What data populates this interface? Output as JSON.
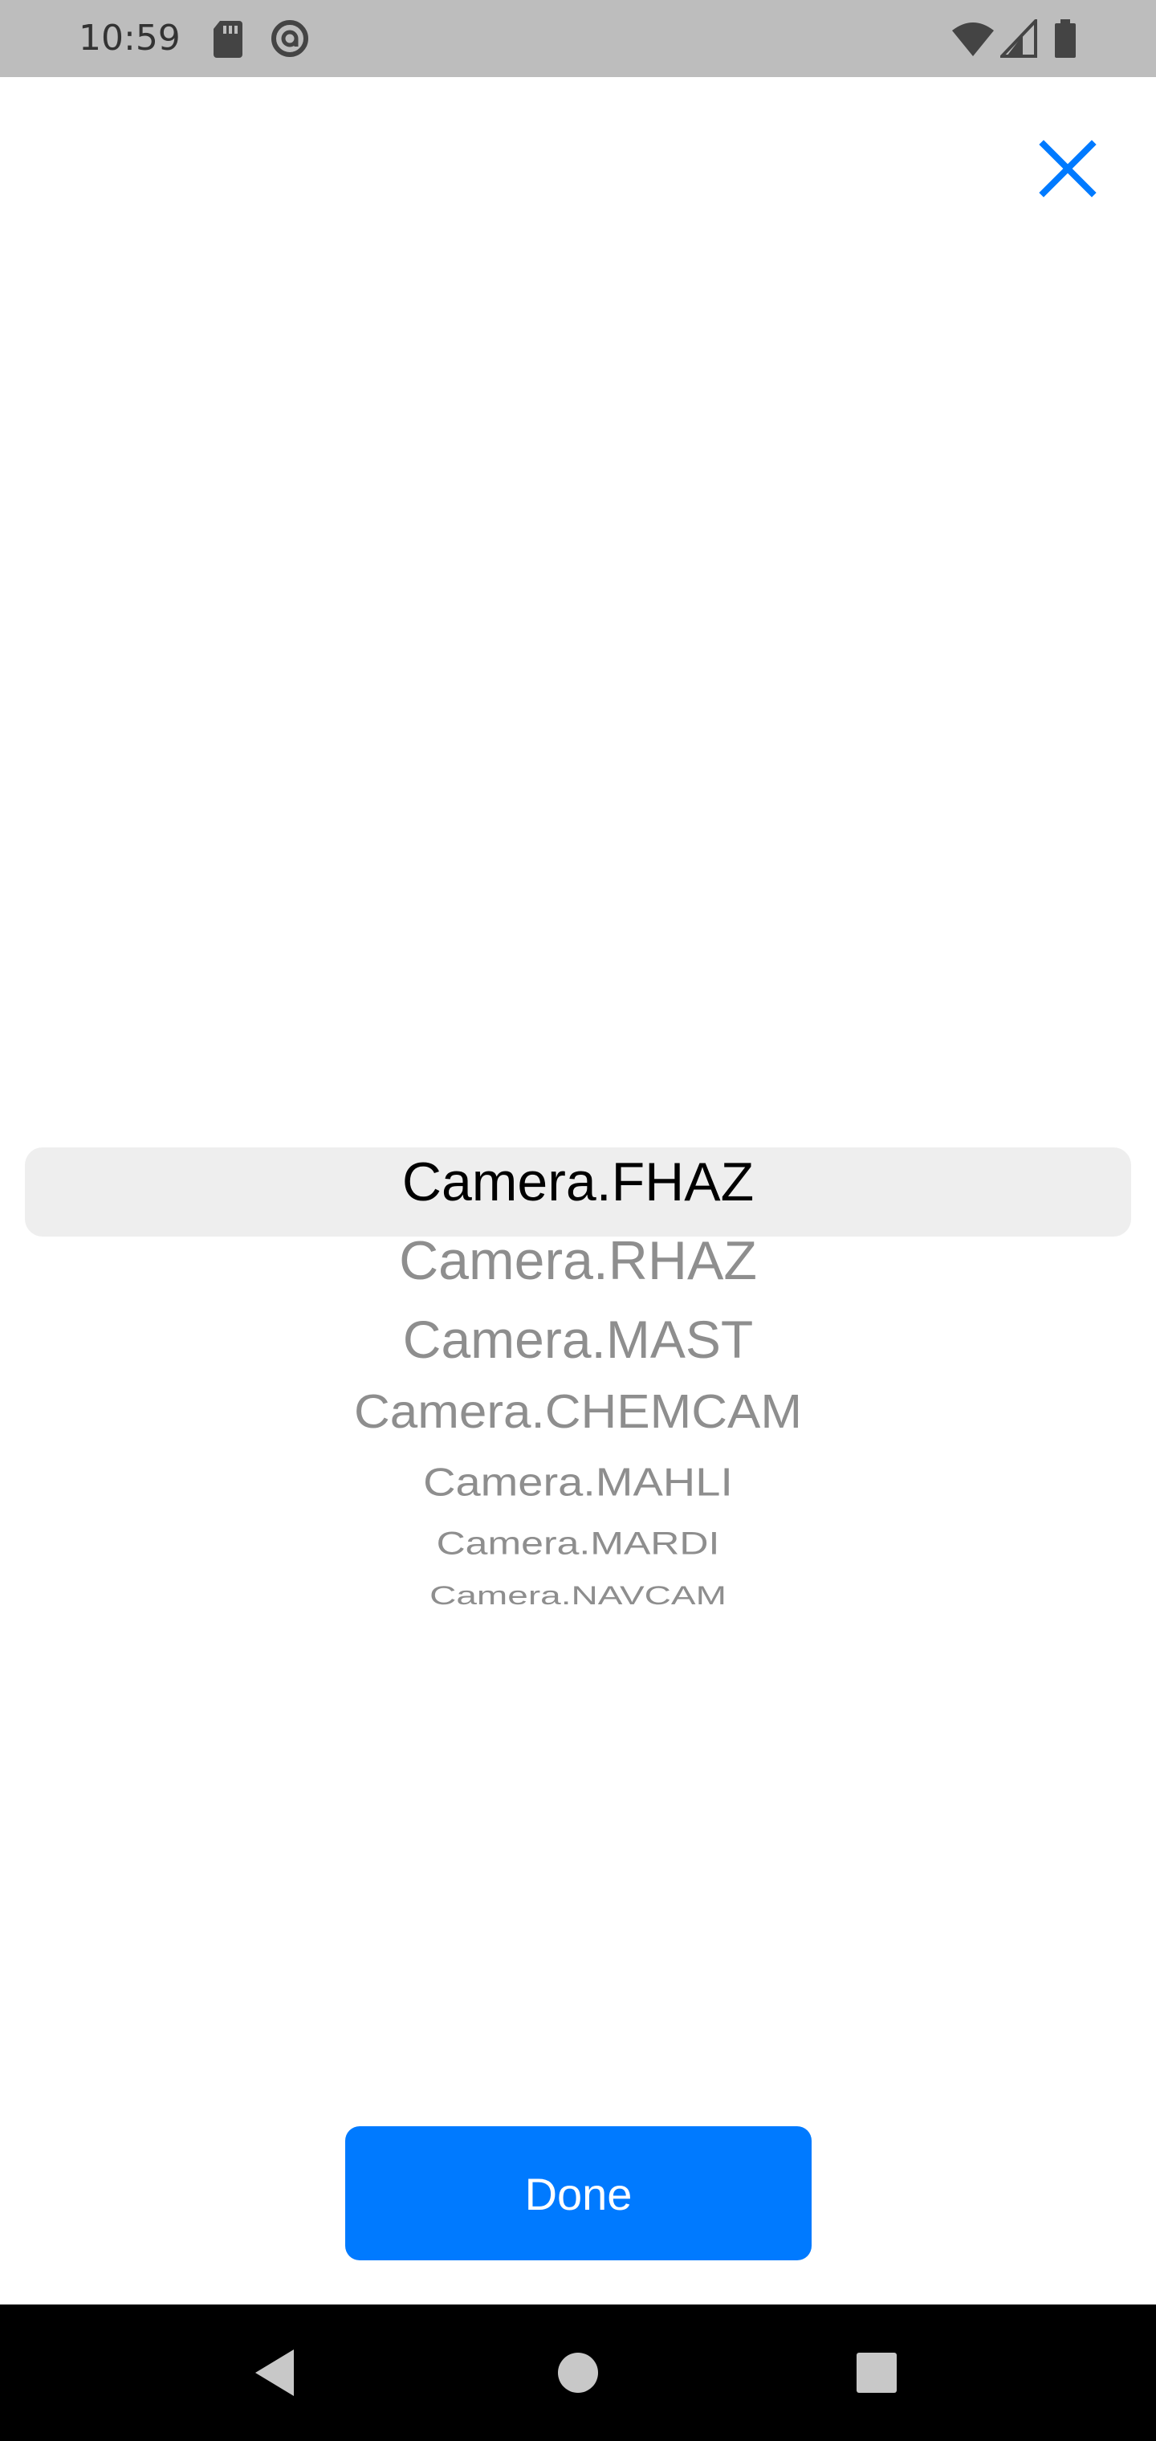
{
  "status_bar": {
    "time": "10:59",
    "icons": [
      "sd-card-icon",
      "vpn-icon",
      "wifi-icon",
      "cellular-signal-icon",
      "battery-icon"
    ]
  },
  "header": {
    "close_icon": "close-icon",
    "accent_color": "#007aff"
  },
  "picker": {
    "selected_index": 0,
    "options": [
      "Camera.FHAZ",
      "Camera.RHAZ",
      "Camera.MAST",
      "Camera.CHEMCAM",
      "Camera.MAHLI",
      "Camera.MARDI",
      "Camera.NAVCAM"
    ]
  },
  "footer": {
    "done_label": "Done"
  },
  "nav_bar": {
    "buttons": [
      "back-icon",
      "home-icon",
      "recents-icon"
    ]
  }
}
